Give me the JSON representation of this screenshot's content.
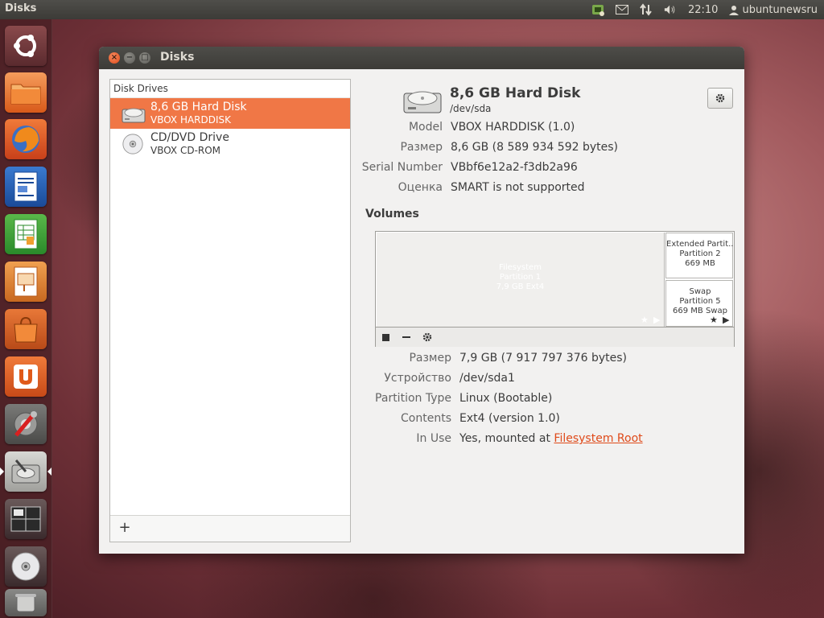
{
  "panel": {
    "app_title": "Disks",
    "clock": "22:10",
    "user": "ubuntunewsru",
    "icons": [
      "network-icon",
      "mail-icon",
      "transfer-icon",
      "volume-icon"
    ]
  },
  "launcher": {
    "items": [
      "ubuntu-dash",
      "files",
      "firefox",
      "libreoffice-writer",
      "libreoffice-calc",
      "libreoffice-impress",
      "software-center",
      "ubuntu-one",
      "system-settings",
      "disks",
      "workspace-switcher",
      "cd-dvd",
      "trash"
    ]
  },
  "window": {
    "title": "Disks",
    "drives_header": "Disk Drives",
    "drives": [
      {
        "name": "8,6 GB Hard Disk",
        "sub": "VBOX HARDDISK",
        "selected": true
      },
      {
        "name": "CD/DVD Drive",
        "sub": "VBOX CD-ROM",
        "selected": false
      }
    ],
    "add_label": "+",
    "disk": {
      "title": "8,6 GB Hard Disk",
      "device": "/dev/sda",
      "props": [
        {
          "k": "Model",
          "v": "VBOX HARDDISK (1.0)"
        },
        {
          "k": "Размер",
          "v": "8,6 GB (8 589 934 592 bytes)"
        },
        {
          "k": "Serial Number",
          "v": "VBbf6e12a2-f3db2a96"
        },
        {
          "k": "Оценка",
          "v": "SMART is not supported"
        }
      ]
    },
    "volumes_label": "Volumes",
    "volumes": [
      {
        "line1": "Filesystem",
        "line2": "Partition 1",
        "line3": "7,9 GB Ext4"
      },
      {
        "line1": "Extended Partit...",
        "line2": "Partition 2",
        "line3": "669 MB"
      },
      {
        "line1": "Swap",
        "line2": "Partition 5",
        "line3": "669 MB Swap"
      }
    ],
    "partition": {
      "props": [
        {
          "k": "Размер",
          "v": "7,9 GB (7 917 797 376 bytes)"
        },
        {
          "k": "Устройство",
          "v": "/dev/sda1"
        },
        {
          "k": "Partition Type",
          "v": "Linux (Bootable)"
        },
        {
          "k": "Contents",
          "v": "Ext4 (version 1.0)"
        },
        {
          "k": "In Use",
          "v": "Yes, mounted at",
          "link": "Filesystem Root"
        }
      ]
    }
  },
  "colors": {
    "accent": "#f07746",
    "link": "#df4a1a",
    "panel": "#3c3b37"
  }
}
